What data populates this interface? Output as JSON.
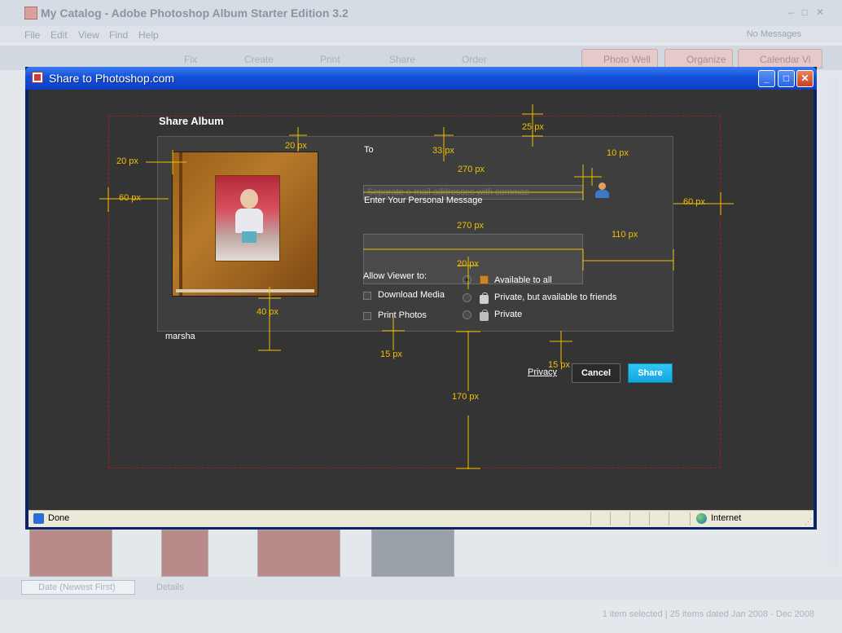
{
  "background_app": {
    "title": "My Catalog - Adobe Photoshop Album Starter Edition 3.2",
    "menu": [
      "File",
      "Edit",
      "View",
      "Find",
      "Help"
    ],
    "no_messages": "No Messages",
    "toolbar": [
      "Fix",
      "Create",
      "Print",
      "Share",
      "Order"
    ],
    "tabs": [
      "Photo Well",
      "Organize",
      "Calendar Vi"
    ],
    "sort_label": "Date (Newest First)",
    "details_label": "Details",
    "status": "1 item selected  |  25 items dated Jan 2008 - Dec 2008"
  },
  "window": {
    "title": "Share to Photoshop.com"
  },
  "share": {
    "heading": "Share Album",
    "album_name": "marsha",
    "to_label": "To",
    "to_placeholder": "Separate e-mail addresses with commas",
    "message_label": "Enter Your Personal Message",
    "allow_label": "Allow Viewer to:",
    "options": [
      "Download Media",
      "Print Photos"
    ],
    "privacy_options": [
      "Available to all",
      "Private, but available to friends",
      "Private"
    ],
    "privacy_link": "Privacy",
    "cancel": "Cancel",
    "share": "Share"
  },
  "measurements": {
    "m1": "20 px",
    "m2": "20 px",
    "m3": "60 px",
    "m4": "33 px",
    "m5": "25 px",
    "m6": "270 px",
    "m7": "10 px",
    "m8": "60 px",
    "m9": "270 px",
    "m10": "110 px",
    "m11": "20 px",
    "m12": "40 px",
    "m13": "15 px",
    "m14": "15 px",
    "m15": "170 px"
  },
  "statusbar": {
    "done": "Done",
    "zone": "Internet"
  }
}
